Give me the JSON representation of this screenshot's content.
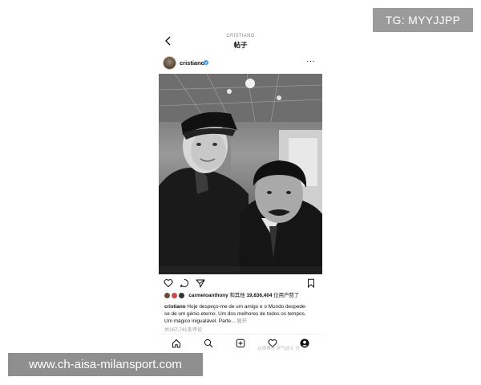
{
  "watermarks": {
    "top": "TG: MYYJJPP",
    "bottom": "www.ch-aisa-milansport.com"
  },
  "nav": {
    "username": "CRISTIANO",
    "title": "帖子"
  },
  "post": {
    "username": "cristiano",
    "verified": true,
    "likes": {
      "liker": "carmeloanthony",
      "connector": " 和其他 ",
      "count": "19,836,404",
      "suffix": " 位用户赞了"
    },
    "caption": {
      "author": "cristiano",
      "text": " Hoje despeço-me de um amigo e o Mundo despede-se de um génio eterno. Um dos melhores de todos os tempos. Um mágico inigualável. Parte...",
      "more": " 展开"
    },
    "comments": "共167,741条评论"
  },
  "overlay": {
    "weibo": "@微博号 英气战士 讯"
  },
  "tabs": [
    "home",
    "search",
    "new-post",
    "activity",
    "profile"
  ],
  "colors": {
    "watermark_top_bg": "#9b9b9b",
    "watermark_bottom_bg": "#8f8f8f",
    "verified": "#3897f0",
    "secondary_text": "#999999"
  }
}
